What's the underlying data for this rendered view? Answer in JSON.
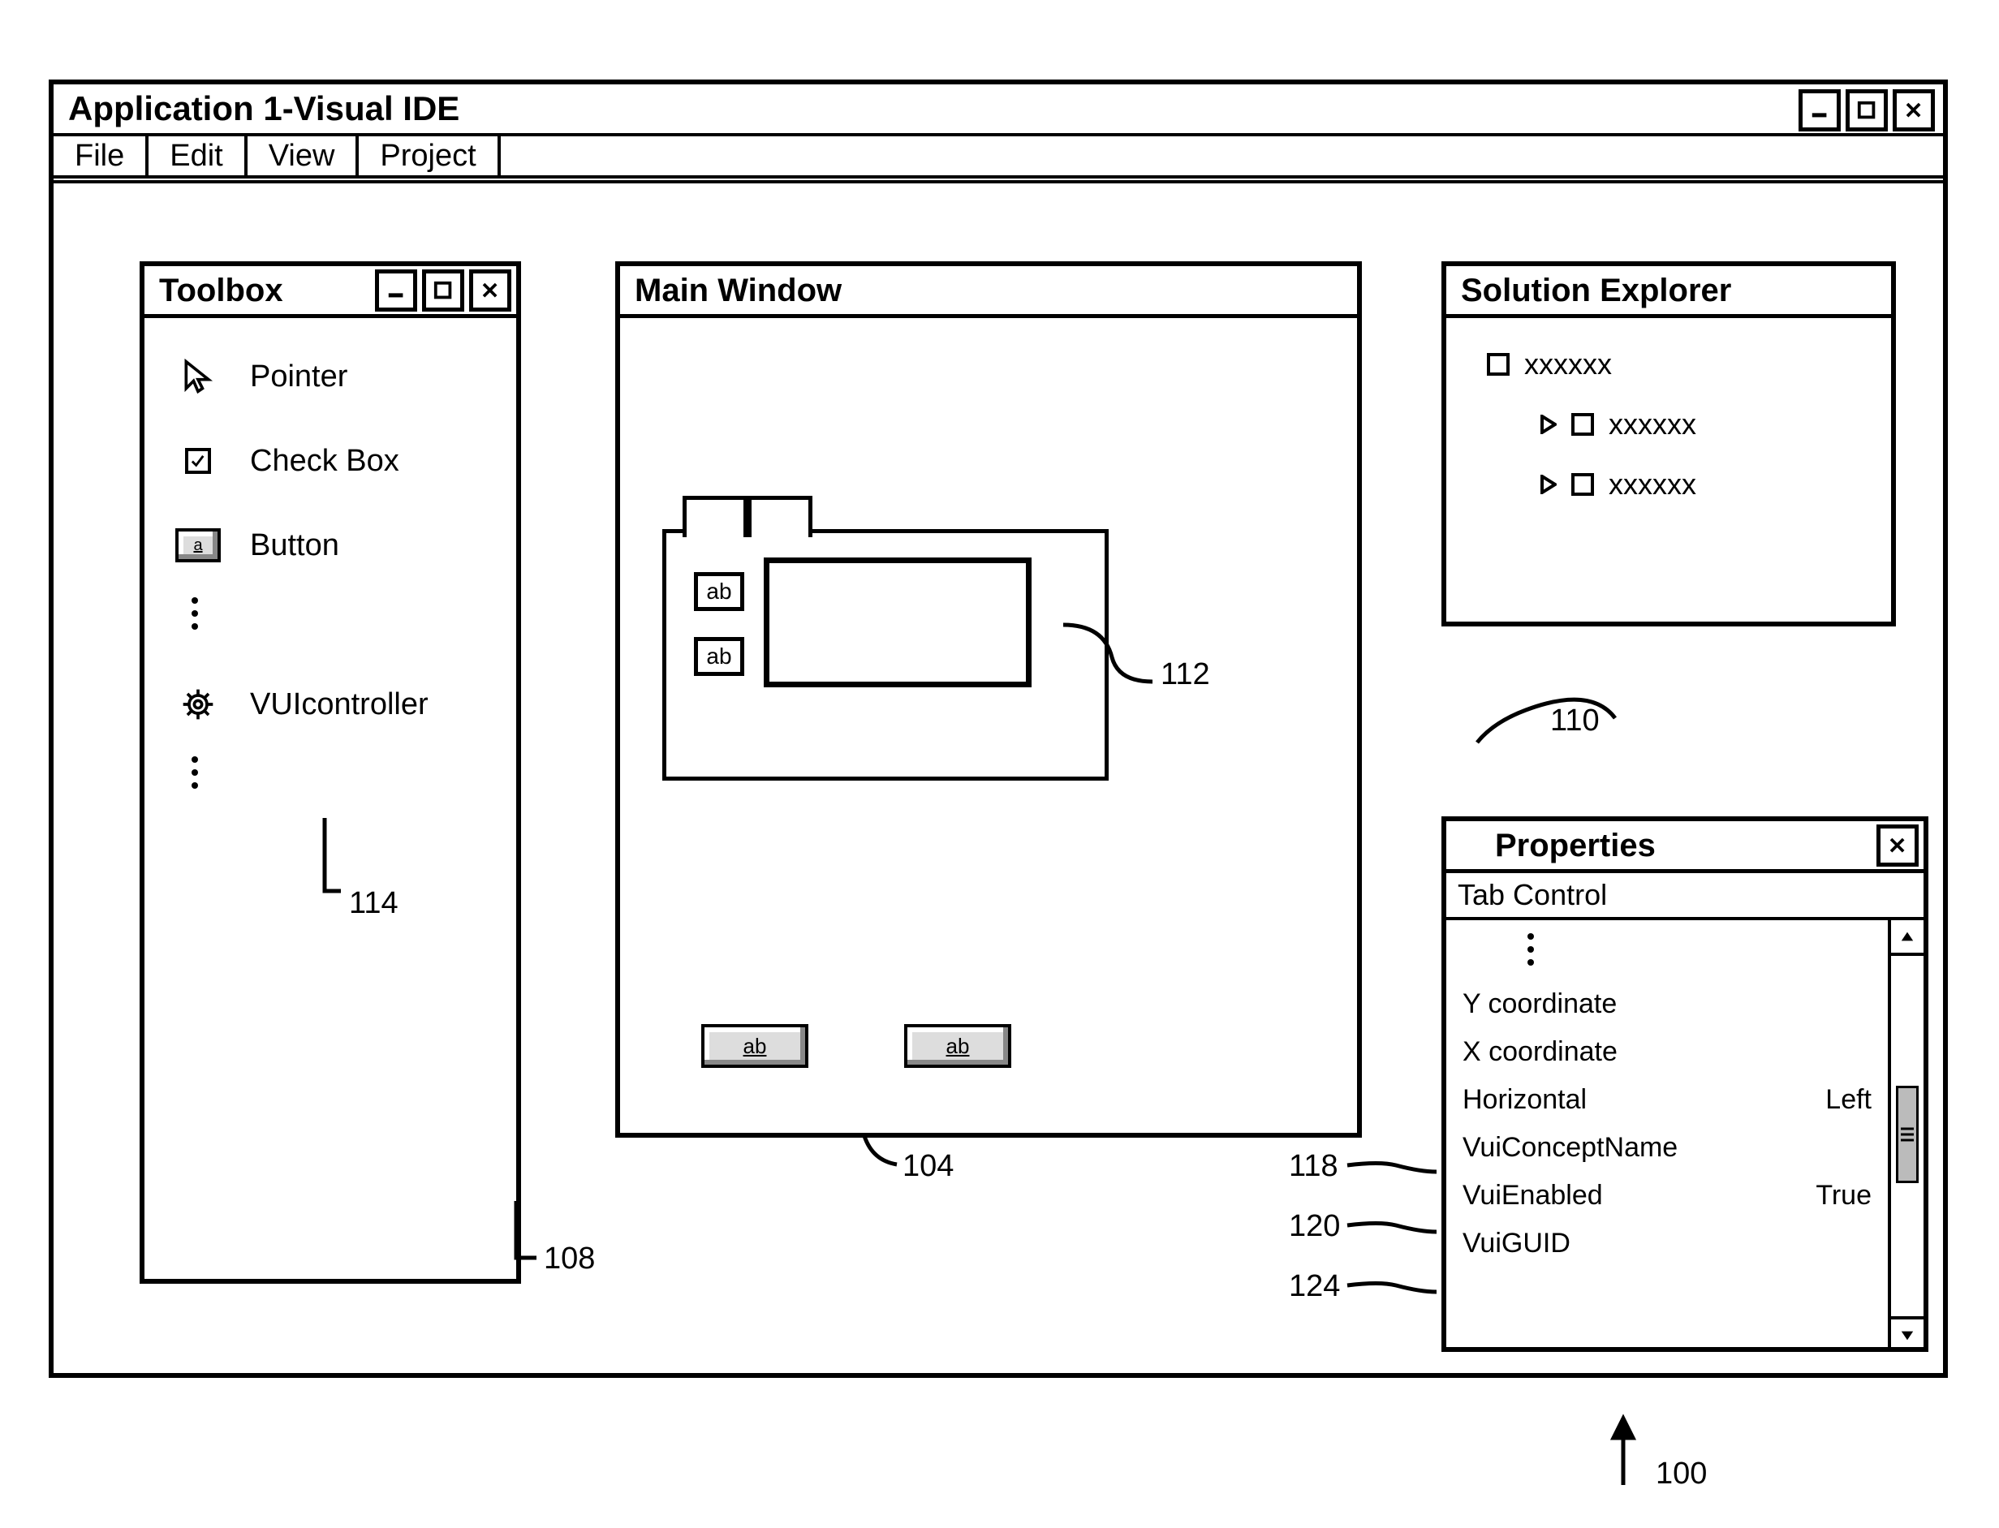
{
  "app": {
    "title": "Application 1-Visual IDE"
  },
  "menubar": {
    "items": [
      "File",
      "Edit",
      "View",
      "Project"
    ]
  },
  "toolbox": {
    "title": "Toolbox",
    "items": [
      {
        "icon": "pointer",
        "label": "Pointer"
      },
      {
        "icon": "checkbox",
        "label": "Check Box"
      },
      {
        "icon": "button",
        "label": "Button"
      },
      {
        "icon": "gear",
        "label": "VUIcontroller"
      }
    ]
  },
  "mainwin": {
    "title": "Main Window",
    "textbox_label": "ab",
    "button_label": "ab"
  },
  "solution_explorer": {
    "title": "Solution Explorer",
    "root": "xxxxxx",
    "children": [
      "xxxxxx",
      "xxxxxx"
    ]
  },
  "properties": {
    "title": "Properties",
    "selected": "Tab Control",
    "rows": [
      {
        "name": "Y coordinate",
        "value": ""
      },
      {
        "name": "X coordinate",
        "value": ""
      },
      {
        "name": "Horizontal",
        "value": "Left"
      },
      {
        "name": "VuiConceptName",
        "value": ""
      },
      {
        "name": "VuiEnabled",
        "value": "True"
      },
      {
        "name": "VuiGUID",
        "value": ""
      }
    ]
  },
  "callouts": {
    "c100": "100",
    "c104": "104",
    "c108": "108",
    "c110": "110",
    "c112": "112",
    "c114": "114",
    "c118": "118",
    "c120": "120",
    "c124": "124"
  }
}
